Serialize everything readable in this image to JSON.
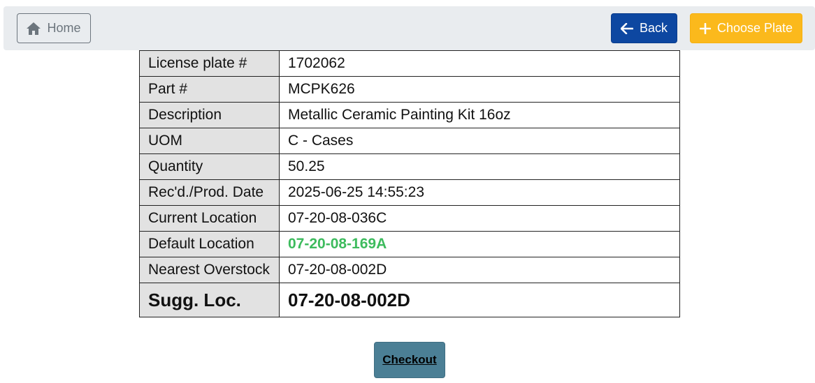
{
  "colors": {
    "topbar_bg": "#e9ecef",
    "back_button": "#0d47a1",
    "choose_button": "#fbb91c",
    "checkout_button": "#4b7f95",
    "default_location_text": "#3dbb5d",
    "label_cell_bg": "#e2e2e2"
  },
  "topbar": {
    "home": {
      "label": "Home",
      "icon": "home-icon"
    },
    "back": {
      "label": "Back",
      "icon": "arrow-left-icon"
    },
    "choose_plate": {
      "label": "Choose Plate",
      "icon": "plus-icon"
    }
  },
  "details": {
    "rows": [
      {
        "label": "License plate #",
        "value": "1702062"
      },
      {
        "label": "Part #",
        "value": "MCPK626"
      },
      {
        "label": "Description",
        "value": "Metallic Ceramic Painting Kit 16oz"
      },
      {
        "label": "UOM",
        "value": "C - Cases"
      },
      {
        "label": "Quantity",
        "value": "50.25"
      },
      {
        "label": "Rec'd./Prod. Date",
        "value": "2025-06-25 14:55:23"
      },
      {
        "label": "Current Location",
        "value": "07-20-08-036C"
      },
      {
        "label": "Default Location",
        "value": "07-20-08-169A"
      },
      {
        "label": "Nearest Overstock",
        "value": "07-20-08-002D"
      },
      {
        "label": "Sugg. Loc.",
        "value": "07-20-08-002D"
      }
    ]
  },
  "checkout": {
    "label": "Checkout"
  }
}
